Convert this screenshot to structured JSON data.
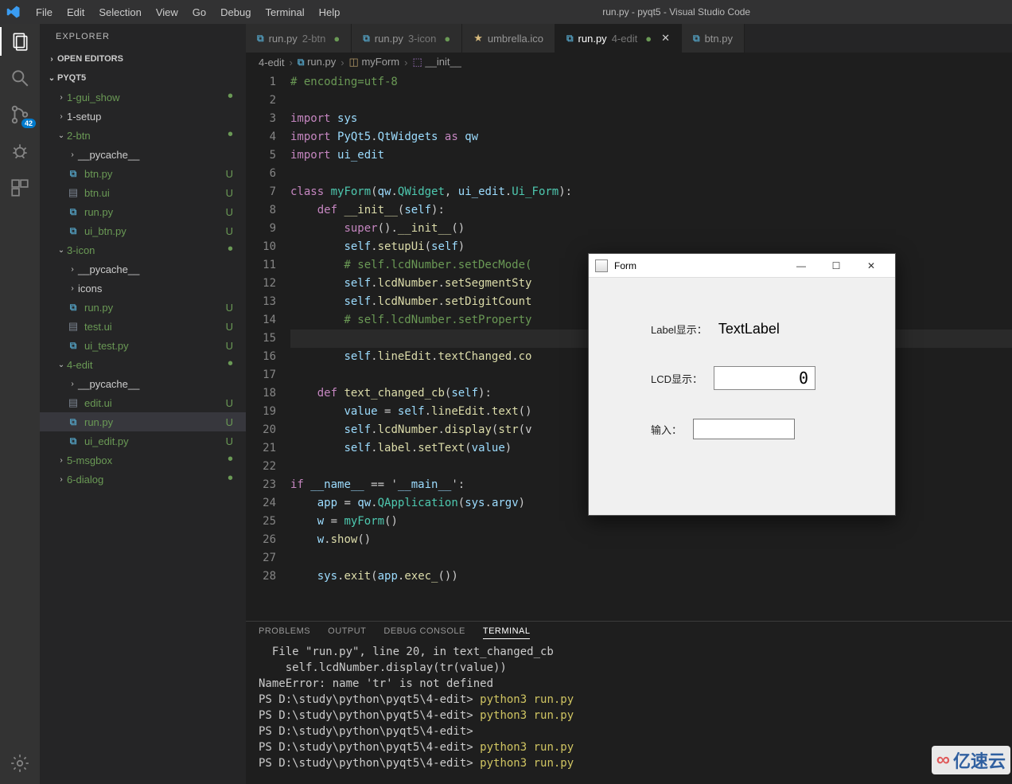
{
  "title": "run.py - pyqt5 - Visual Studio Code",
  "menu": [
    "File",
    "Edit",
    "Selection",
    "View",
    "Go",
    "Debug",
    "Terminal",
    "Help"
  ],
  "activity": {
    "scm_badge": "42"
  },
  "sidebar": {
    "title": "EXPLORER",
    "open_editors": "OPEN EDITORS",
    "root": "PYQT5",
    "items": [
      {
        "label": "1-gui_show",
        "kind": "folder",
        "chev": "›",
        "indent": 1,
        "git": "dot"
      },
      {
        "label": "1-setup",
        "kind": "folder",
        "chev": "›",
        "indent": 1,
        "git": ""
      },
      {
        "label": "2-btn",
        "kind": "folder",
        "chev": "⌄",
        "indent": 1,
        "git": "dot"
      },
      {
        "label": "__pycache__",
        "kind": "folder",
        "chev": "›",
        "indent": 2,
        "git": ""
      },
      {
        "label": "btn.py",
        "kind": "py",
        "indent": 2,
        "git": "U"
      },
      {
        "label": "btn.ui",
        "kind": "ui",
        "indent": 2,
        "git": "U"
      },
      {
        "label": "run.py",
        "kind": "py",
        "indent": 2,
        "git": "U"
      },
      {
        "label": "ui_btn.py",
        "kind": "py",
        "indent": 2,
        "git": "U"
      },
      {
        "label": "3-icon",
        "kind": "folder",
        "chev": "⌄",
        "indent": 1,
        "git": "dot"
      },
      {
        "label": "__pycache__",
        "kind": "folder",
        "chev": "›",
        "indent": 2,
        "git": ""
      },
      {
        "label": "icons",
        "kind": "folder",
        "chev": "›",
        "indent": 2,
        "git": ""
      },
      {
        "label": "run.py",
        "kind": "py",
        "indent": 2,
        "git": "U"
      },
      {
        "label": "test.ui",
        "kind": "ui",
        "indent": 2,
        "git": "U"
      },
      {
        "label": "ui_test.py",
        "kind": "py",
        "indent": 2,
        "git": "U"
      },
      {
        "label": "4-edit",
        "kind": "folder",
        "chev": "⌄",
        "indent": 1,
        "git": "dot"
      },
      {
        "label": "__pycache__",
        "kind": "folder",
        "chev": "›",
        "indent": 2,
        "git": ""
      },
      {
        "label": "edit.ui",
        "kind": "ui",
        "indent": 2,
        "git": "U"
      },
      {
        "label": "run.py",
        "kind": "py",
        "indent": 2,
        "git": "U",
        "selected": true
      },
      {
        "label": "ui_edit.py",
        "kind": "py",
        "indent": 2,
        "git": "U"
      },
      {
        "label": "5-msgbox",
        "kind": "folder",
        "chev": "›",
        "indent": 1,
        "git": "dot"
      },
      {
        "label": "6-dialog",
        "kind": "folder",
        "chev": "›",
        "indent": 1,
        "git": "dot"
      }
    ]
  },
  "tabs": [
    {
      "label": "run.py",
      "suffix": "2-btn",
      "icon": "py",
      "git": "dot"
    },
    {
      "label": "run.py",
      "suffix": "3-icon",
      "icon": "py",
      "git": "dot"
    },
    {
      "label": "umbrella.ico",
      "suffix": "",
      "icon": "star",
      "git": ""
    },
    {
      "label": "run.py",
      "suffix": "4-edit",
      "icon": "py",
      "git": "dot",
      "active": true
    },
    {
      "label": "btn.py",
      "suffix": "",
      "icon": "py",
      "git": ""
    }
  ],
  "breadcrumbs": [
    "4-edit",
    "run.py",
    "myForm",
    "__init__"
  ],
  "code": {
    "lines": [
      "# encoding=utf-8",
      "",
      "import sys",
      "import PyQt5.QtWidgets as qw",
      "import ui_edit",
      "",
      "class myForm(qw.QWidget, ui_edit.Ui_Form):",
      "    def __init__(self):",
      "        super().__init__()",
      "        self.setupUi(self)",
      "        # self.lcdNumber.setDecMode(",
      "        self.lcdNumber.setSegmentSty",
      "        self.lcdNumber.setDigitCount",
      "        # self.lcdNumber.setProperty",
      "",
      "        self.lineEdit.textChanged.co",
      "",
      "    def text_changed_cb(self):",
      "        value = self.lineEdit.text()",
      "        self.lcdNumber.display(str(v",
      "        self.label.setText(value)",
      "",
      "if __name__ == '__main__':",
      "    app = qw.QApplication(sys.argv)",
      "    w = myForm()",
      "    w.show()",
      "",
      "    sys.exit(app.exec_())"
    ]
  },
  "panel": {
    "tabs": [
      "PROBLEMS",
      "OUTPUT",
      "DEBUG CONSOLE",
      "TERMINAL"
    ],
    "active": 3,
    "lines": [
      {
        "t": "  File \"run.py\", line 20, in text_changed_cb",
        "c": ""
      },
      {
        "t": "    self.lcdNumber.display(tr(value))",
        "c": ""
      },
      {
        "t": "NameError: name 'tr' is not defined",
        "c": ""
      },
      {
        "t": "PS D:\\study\\python\\pyqt5\\4-edit> ",
        "cmd": "python3 run.py"
      },
      {
        "t": "PS D:\\study\\python\\pyqt5\\4-edit> ",
        "cmd": "python3 run.py"
      },
      {
        "t": "PS D:\\study\\python\\pyqt5\\4-edit>",
        "cmd": ""
      },
      {
        "t": "PS D:\\study\\python\\pyqt5\\4-edit> ",
        "cmd": "python3 run.py"
      },
      {
        "t": "PS D:\\study\\python\\pyqt5\\4-edit> ",
        "cmd": "python3 run.py"
      }
    ]
  },
  "form": {
    "title": "Form",
    "label_text_label": "Label显示：",
    "label_text_value": "TextLabel",
    "lcd_label": "LCD显示：",
    "lcd_value": "0",
    "input_label": "输入：",
    "input_value": ""
  },
  "watermark": "亿速云"
}
